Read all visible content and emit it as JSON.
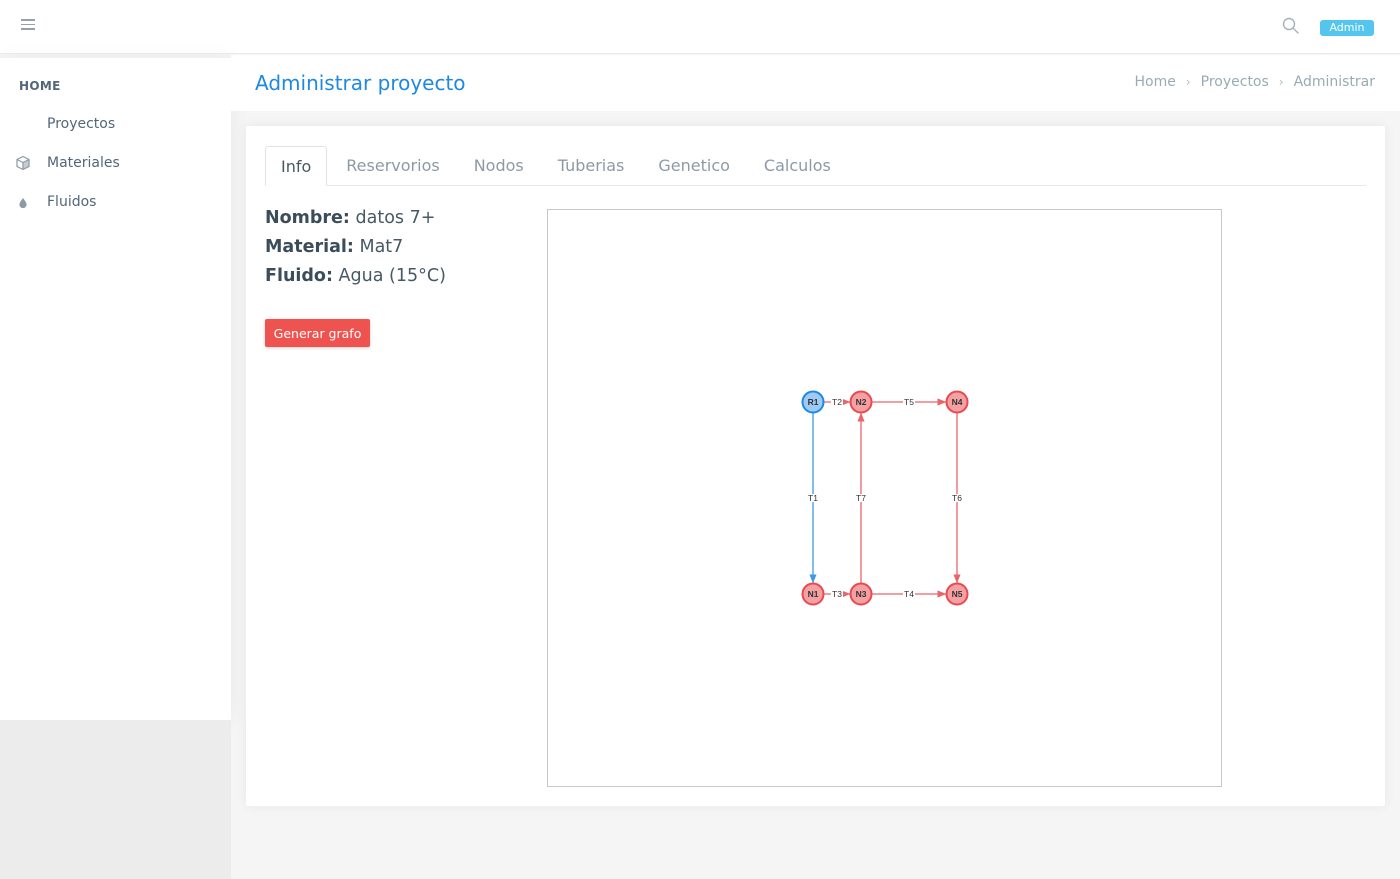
{
  "topbar": {
    "menu_icon": "hamburger-icon",
    "search_icon": "search-icon",
    "user_badge": "Admin",
    "badge_color": "#54c6ee"
  },
  "sidebar": {
    "heading": "HOME",
    "items": [
      {
        "label": "Proyectos",
        "icon": ""
      },
      {
        "label": "Materiales",
        "icon": "cube-icon"
      },
      {
        "label": "Fluidos",
        "icon": "droplet-icon"
      }
    ]
  },
  "header": {
    "title": "Administrar proyecto",
    "title_color": "#1e88e5",
    "breadcrumb": [
      "Home",
      "Proyectos",
      "Administrar"
    ]
  },
  "tabs": [
    "Info",
    "Reservorios",
    "Nodos",
    "Tuberias",
    "Genetico",
    "Calculos"
  ],
  "active_tab": "Info",
  "info": {
    "nombre_label": "Nombre:",
    "nombre_value": "datos 7+",
    "material_label": "Material:",
    "material_value": "Mat7",
    "fluido_label": "Fluido:",
    "fluido_value": "Agua (15°C)"
  },
  "generate_button": "Generar grafo",
  "button_color": "#ef5350",
  "graph": {
    "reservoir_color": "#1e88e5",
    "node_color": "#e84a4f",
    "nodes": [
      {
        "id": "R1",
        "type": "reservoir"
      },
      {
        "id": "N2",
        "type": "node"
      },
      {
        "id": "N4",
        "type": "node"
      },
      {
        "id": "N1",
        "type": "node"
      },
      {
        "id": "N3",
        "type": "node"
      },
      {
        "id": "N5",
        "type": "node"
      }
    ],
    "edges": [
      {
        "label": "T2",
        "from": "R1",
        "to": "N2"
      },
      {
        "label": "T5",
        "from": "N2",
        "to": "N4"
      },
      {
        "label": "T1",
        "from": "R1",
        "to": "N1"
      },
      {
        "label": "T7",
        "from": "N3",
        "to": "N2"
      },
      {
        "label": "T6",
        "from": "N4",
        "to": "N5"
      },
      {
        "label": "T3",
        "from": "N1",
        "to": "N3"
      },
      {
        "label": "T4",
        "from": "N3",
        "to": "N5"
      }
    ]
  }
}
